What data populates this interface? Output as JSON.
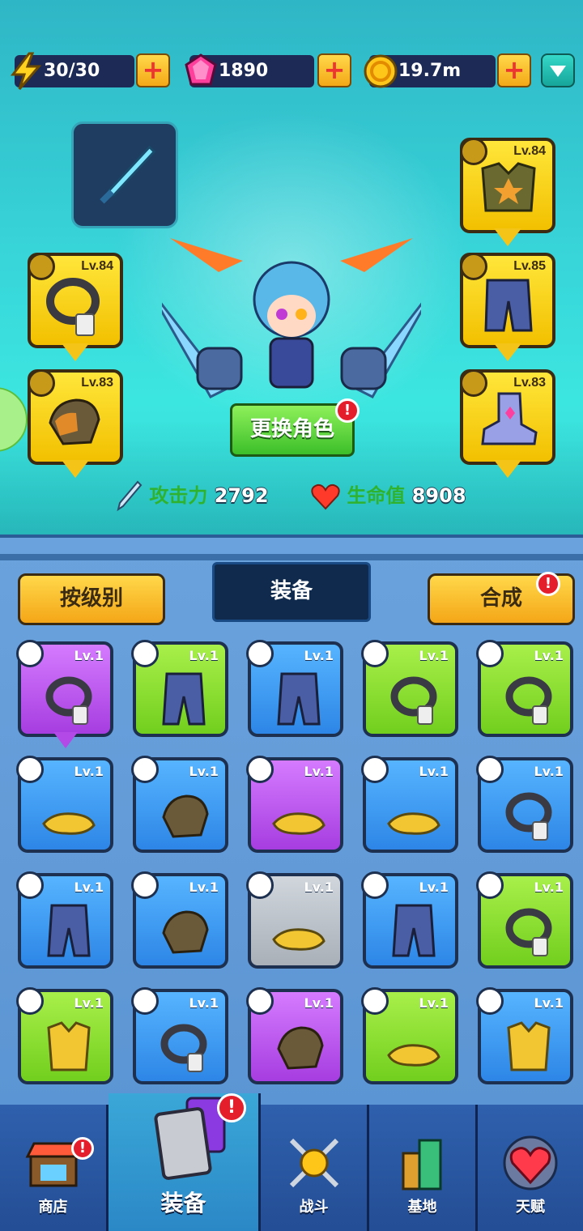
{
  "resources": {
    "energy": "30/30",
    "gems": "1890",
    "coins": "19.7m"
  },
  "hero": {
    "change_character": "更换角色",
    "attack_label": "攻击力",
    "attack_value": "2792",
    "hp_label": "生命值",
    "hp_value": "8908",
    "alert": "!",
    "slots": {
      "necklace": "Lv.84",
      "gloves": "Lv.83",
      "armor": "Lv.84",
      "pants": "Lv.85",
      "shoes": "Lv.83"
    }
  },
  "inventory": {
    "sort_button": "按级别",
    "tab_title": "装备",
    "merge_button": "合成",
    "merge_alert": "!",
    "items": [
      {
        "lv": "Lv.1",
        "rarity": "purple",
        "type": "necklace"
      },
      {
        "lv": "Lv.1",
        "rarity": "green",
        "type": "pants"
      },
      {
        "lv": "Lv.1",
        "rarity": "blue",
        "type": "pants"
      },
      {
        "lv": "Lv.1",
        "rarity": "green",
        "type": "necklace"
      },
      {
        "lv": "Lv.1",
        "rarity": "green",
        "type": "necklace"
      },
      {
        "lv": "Lv.1",
        "rarity": "blue",
        "type": "shoes"
      },
      {
        "lv": "Lv.1",
        "rarity": "blue",
        "type": "gloves"
      },
      {
        "lv": "Lv.1",
        "rarity": "purple",
        "type": "shoes"
      },
      {
        "lv": "Lv.1",
        "rarity": "blue",
        "type": "shoes"
      },
      {
        "lv": "Lv.1",
        "rarity": "blue",
        "type": "necklace"
      },
      {
        "lv": "Lv.1",
        "rarity": "blue",
        "type": "pants"
      },
      {
        "lv": "Lv.1",
        "rarity": "blue",
        "type": "gloves"
      },
      {
        "lv": "Lv.1",
        "rarity": "grey",
        "type": "shoes"
      },
      {
        "lv": "Lv.1",
        "rarity": "blue",
        "type": "pants"
      },
      {
        "lv": "Lv.1",
        "rarity": "green",
        "type": "necklace"
      },
      {
        "lv": "Lv.1",
        "rarity": "green",
        "type": "armor"
      },
      {
        "lv": "Lv.1",
        "rarity": "blue",
        "type": "necklace"
      },
      {
        "lv": "Lv.1",
        "rarity": "purple",
        "type": "gloves"
      },
      {
        "lv": "Lv.1",
        "rarity": "green",
        "type": "shoes"
      },
      {
        "lv": "Lv.1",
        "rarity": "blue",
        "type": "armor"
      }
    ]
  },
  "nav": {
    "shop": "商店",
    "equip": "装备",
    "battle": "战斗",
    "base": "基地",
    "talent": "天赋",
    "alert": "!"
  },
  "colors": {
    "purple": "#a63de0",
    "green": "#72cf1e",
    "blue": "#2d86e6",
    "grey": "#a9b0b8",
    "gold": "#f4c518"
  }
}
